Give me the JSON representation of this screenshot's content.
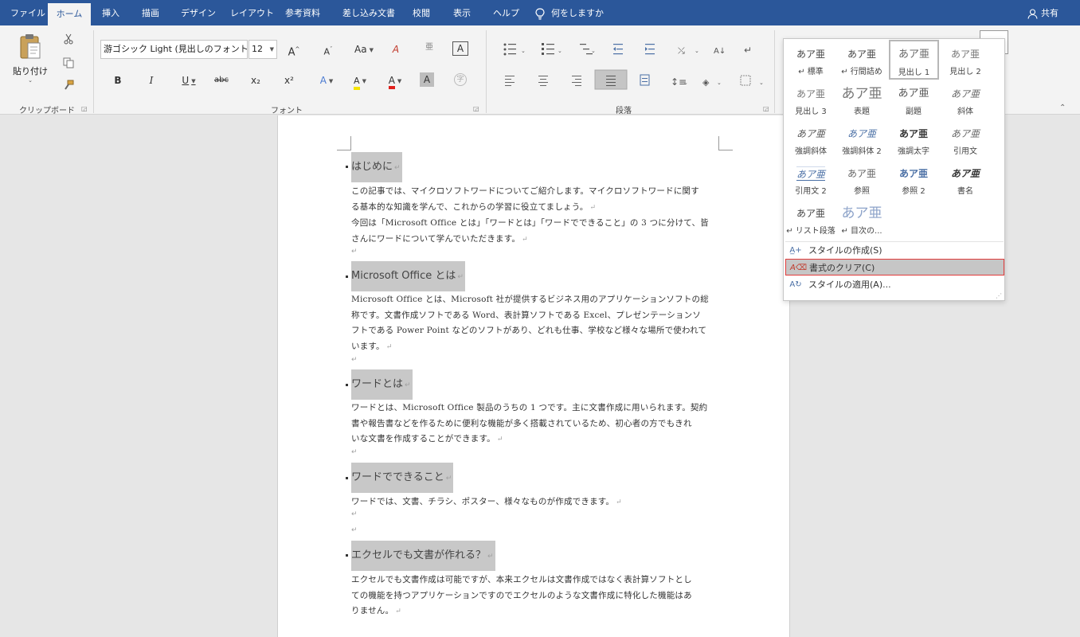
{
  "tabs": [
    {
      "label": "ファイル",
      "active": false
    },
    {
      "label": "ホーム",
      "active": true
    },
    {
      "label": "挿入",
      "active": false
    },
    {
      "label": "描画",
      "active": false
    },
    {
      "label": "デザイン",
      "active": false
    },
    {
      "label": "レイアウト",
      "active": false
    },
    {
      "label": "参考資料",
      "active": false
    },
    {
      "label": "差し込み文書",
      "active": false
    },
    {
      "label": "校閲",
      "active": false
    },
    {
      "label": "表示",
      "active": false
    },
    {
      "label": "ヘルプ",
      "active": false
    }
  ],
  "tell_me": "何をしますか",
  "share": "共有",
  "ribbon": {
    "clipboard": {
      "paste_label": "貼り付け",
      "group_label": "クリップボード"
    },
    "font": {
      "font_name": "游ゴシック Light (見出しのフォント - 日",
      "font_size": "12",
      "group_label": "フォント",
      "glyphs": {
        "grow": "A",
        "shrink": "A",
        "case": "Aa",
        "clear": "A",
        "phonetic": "亜",
        "border": "A",
        "bold": "B",
        "italic": "I",
        "underline": "U",
        "strike": "abc",
        "subscript": "x₂",
        "superscript": "x²",
        "effects": "A",
        "font_color": "A",
        "shading": "A",
        "enclose": "字"
      }
    },
    "paragraph": {
      "group_label": "段落"
    }
  },
  "document": {
    "sections": [
      {
        "heading": "はじめに",
        "lines": [
          "この記事では、マイクロソフトワードについてご紹介します。マイクロソフトワードに関す",
          "る基本的な知識を学んで、これからの学習に役立てましょう。",
          "今回は「Microsoft Office とは」「ワードとは」「ワードでできること」の 3 つに分けて、皆",
          "さんにワードについて学んでいただきます。"
        ]
      },
      {
        "heading": "Microsoft Office とは",
        "lines": [
          "Microsoft Office とは、Microsoft 社が提供するビジネス用のアプリケーションソフトの総",
          "称です。文書作成ソフトである Word、表計算ソフトである Excel、プレゼンテーションソ",
          "フトである Power Point などのソフトがあり、どれも仕事、学校など様々な場所で使われて",
          "います。"
        ]
      },
      {
        "heading": "ワードとは",
        "lines": [
          "ワードとは、Microsoft Office 製品のうちの 1 つです。主に文書作成に用いられます。契約",
          "書や報告書などを作るために便利な機能が多く搭載されているため、初心者の方でもきれ",
          "いな文書を作成することができます。"
        ]
      },
      {
        "heading": "ワードでできること",
        "lines": [
          "ワードでは、文書、チラシ、ポスター、様々なものが作成できます。"
        ]
      },
      {
        "heading": "エクセルでも文書が作れる？",
        "lines": [
          "エクセルでも文書作成は可能ですが、本来エクセルは文書作成ではなく表計算ソフトとし",
          "ての機能を持つアプリケーションですのでエクセルのような文書作成に特化した機能はあ",
          "りません。"
        ]
      }
    ],
    "paragraph_mark": "↵"
  },
  "styles_gallery": {
    "preview_text": "あア亜",
    "items": [
      {
        "name": "↵ 標準"
      },
      {
        "name": "↵ 行間詰め"
      },
      {
        "name": "見出し 1",
        "selected": true
      },
      {
        "name": "見出し 2"
      },
      {
        "name": "見出し 3"
      },
      {
        "name": "表題"
      },
      {
        "name": "副題"
      },
      {
        "name": "斜体"
      },
      {
        "name": "強調斜体"
      },
      {
        "name": "強調斜体 2"
      },
      {
        "name": "強調太字"
      },
      {
        "name": "引用文"
      },
      {
        "name": "引用文 2"
      },
      {
        "name": "参照"
      },
      {
        "name": "参照 2"
      },
      {
        "name": "書名"
      },
      {
        "name": "↵ リスト段落"
      },
      {
        "name": "↵ 目次の..."
      }
    ],
    "menu": [
      {
        "label": "スタイルの作成(S)",
        "icon": "create-style-icon",
        "highlight": false
      },
      {
        "label": "書式のクリア(C)",
        "icon": "clear-formatting-icon",
        "highlight": true
      },
      {
        "label": "スタイルの適用(A)...",
        "icon": "apply-styles-icon",
        "highlight": false
      }
    ]
  },
  "colors": {
    "tabbar": "#2b579a",
    "ribbon": "#f3f3f3",
    "highlight_border": "#e23b3b",
    "heading_bg": "#c8c8c8",
    "link_style_blue": "#4a6fa5"
  }
}
